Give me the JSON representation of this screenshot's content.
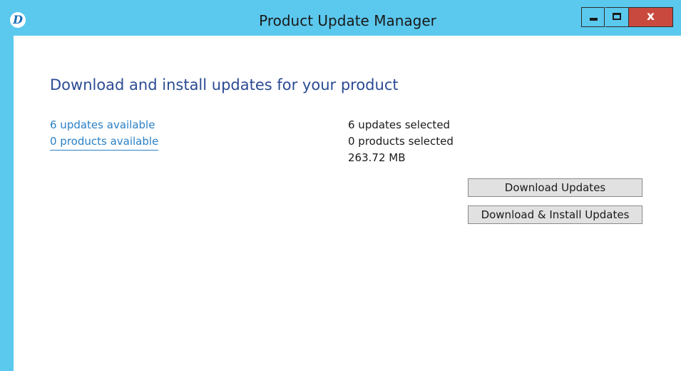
{
  "window": {
    "title": "Product Update Manager",
    "app_icon_glyph": "D",
    "controls": {
      "close_glyph": "x",
      "close_color": "#c9493f"
    },
    "frame_color": "#5bc8ee"
  },
  "main": {
    "heading": "Download and install updates for your product",
    "links": {
      "updates_available": "6 updates available",
      "products_available": "0 products available"
    },
    "summary": {
      "updates_selected": "6 updates selected",
      "products_selected": "0 products selected",
      "total_size": "263.72 MB"
    },
    "buttons": {
      "download": "Download Updates",
      "download_install": "Download & Install Updates"
    }
  },
  "icons": {
    "app": "product-logo-icon",
    "minimize": "minimize-icon",
    "maximize": "maximize-icon",
    "close": "close-icon"
  }
}
